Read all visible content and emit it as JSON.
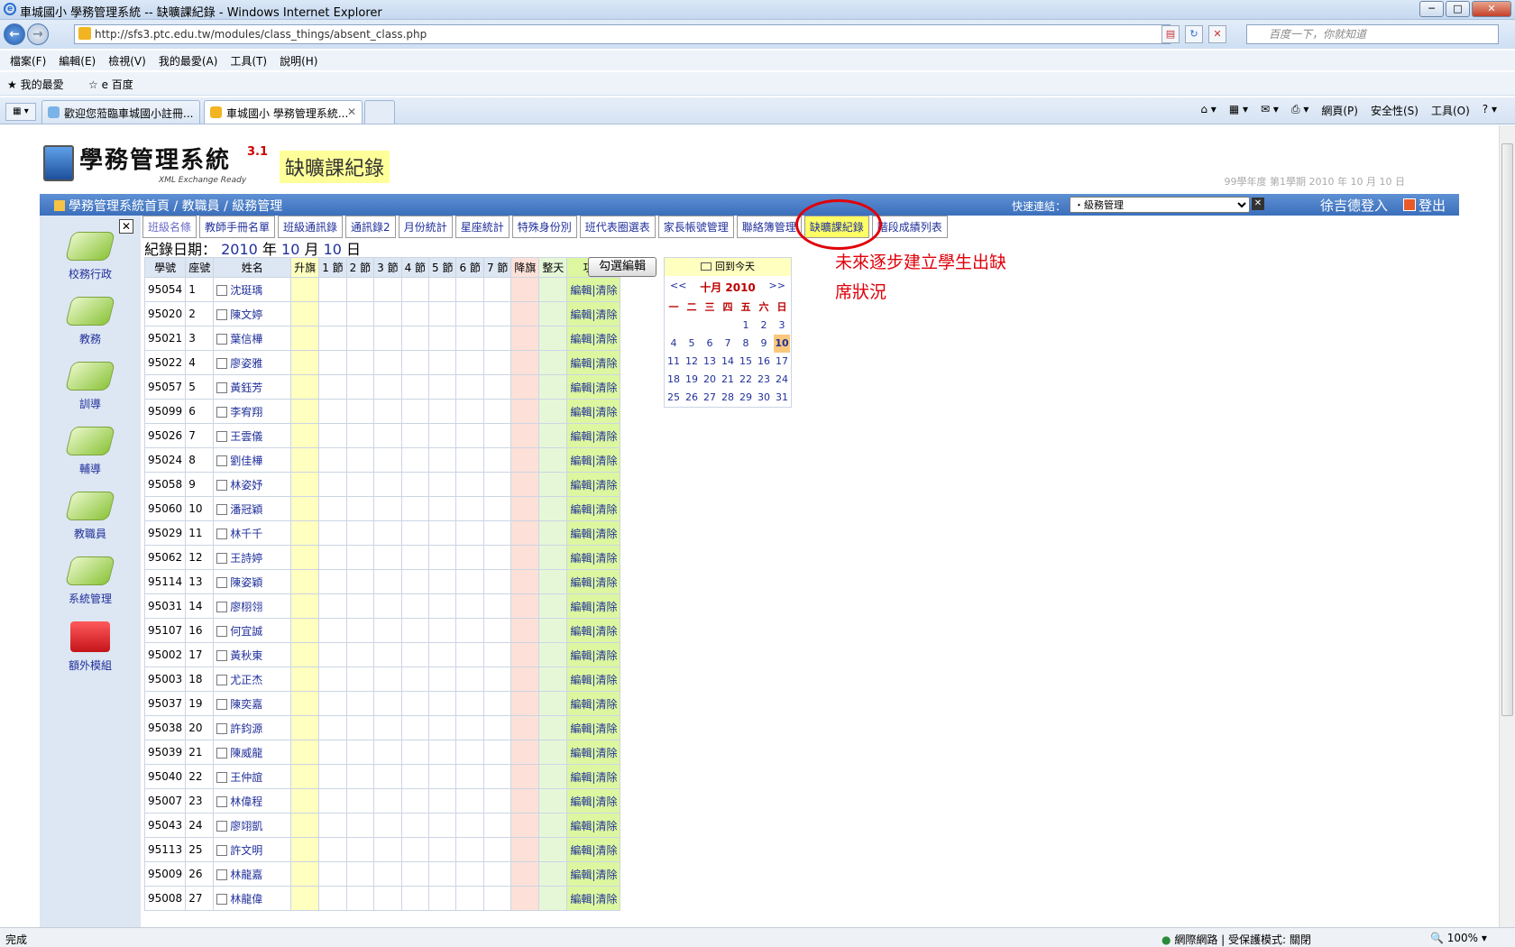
{
  "browser": {
    "window_title": "車城國小 學務管理系統 -- 缺曠課紀錄 - Windows Internet Explorer",
    "url": "http://sfs3.ptc.edu.tw/modules/class_things/absent_class.php",
    "search_placeholder": "百度一下，你就知道",
    "menu": [
      "檔案(F)",
      "編輯(E)",
      "檢視(V)",
      "我的最愛(A)",
      "工具(T)",
      "說明(H)"
    ],
    "favorites_label": "我的最愛",
    "fav_link": "百度",
    "tabs": [
      {
        "label": "歡迎您蒞臨車城國小註冊..."
      },
      {
        "label": "車城國小 學務管理系統..."
      }
    ],
    "command_bar": [
      "網頁(P)",
      "安全性(S)",
      "工具(O)"
    ],
    "status_text": "完成",
    "zone_text": "網際網路 | 受保護模式: 關閉",
    "zoom": "100%"
  },
  "header": {
    "logo_name": "學務管理系統",
    "logo_version": "3.1",
    "logo_tagline": "XML Exchange Ready",
    "page_title": "缺曠課紀錄",
    "semester": "99學年度 第1學期 2010 年 10 月 10 日",
    "breadcrumb": "學務管理系統首頁 / 教職員 / 級務管理",
    "quick_link_label": "快速連結：",
    "quick_link_value": "・級務管理",
    "user": "徐吉德登入",
    "logout": "登出"
  },
  "sidebar": {
    "items": [
      {
        "label": "校務行政",
        "icon": "green-pad-icon"
      },
      {
        "label": "教務",
        "icon": "green-pad-icon"
      },
      {
        "label": "訓導",
        "icon": "green-pad-icon"
      },
      {
        "label": "輔導",
        "icon": "green-pad-icon"
      },
      {
        "label": "教職員",
        "icon": "green-pad-icon"
      },
      {
        "label": "系統管理",
        "icon": "green-pad-icon"
      },
      {
        "label": "額外模組",
        "icon": "red-folder-icon"
      }
    ]
  },
  "nav_tabs": [
    {
      "label": "班級名條"
    },
    {
      "label": "教師手冊名單"
    },
    {
      "label": "班級通訊錄"
    },
    {
      "label": "通訊錄2"
    },
    {
      "label": "月份統計"
    },
    {
      "label": "星座統計"
    },
    {
      "label": "特殊身份別"
    },
    {
      "label": "班代表圈選表"
    },
    {
      "label": "家長帳號管理"
    },
    {
      "label": "聯絡簿管理"
    },
    {
      "label": "缺曠課紀錄"
    },
    {
      "label": "階段成績列表"
    }
  ],
  "record": {
    "prefix": "紀錄日期：",
    "year": "2010",
    "year_unit": "年",
    "month": "10",
    "month_unit": "月",
    "day": "10",
    "day_unit": "日"
  },
  "table": {
    "headers": [
      "學號",
      "座號",
      "姓名",
      "升旗",
      "1 節",
      "2 節",
      "3 節",
      "4 節",
      "5 節",
      "6 節",
      "7 節",
      "降旗",
      "整天",
      "功能"
    ],
    "action_label": "編輯|清除",
    "rows": [
      {
        "id": "95054",
        "seat": "1",
        "name": "沈珽瑀"
      },
      {
        "id": "95020",
        "seat": "2",
        "name": "陳文婷"
      },
      {
        "id": "95021",
        "seat": "3",
        "name": "葉信樺"
      },
      {
        "id": "95022",
        "seat": "4",
        "name": "廖姿雅"
      },
      {
        "id": "95057",
        "seat": "5",
        "name": "黃鈺芳"
      },
      {
        "id": "95099",
        "seat": "6",
        "name": "李宥翔"
      },
      {
        "id": "95026",
        "seat": "7",
        "name": "王雲儀"
      },
      {
        "id": "95024",
        "seat": "8",
        "name": "劉佳樺"
      },
      {
        "id": "95058",
        "seat": "9",
        "name": "林姿妤"
      },
      {
        "id": "95060",
        "seat": "10",
        "name": "潘冠穎"
      },
      {
        "id": "95029",
        "seat": "11",
        "name": "林千千"
      },
      {
        "id": "95062",
        "seat": "12",
        "name": "王詩婷"
      },
      {
        "id": "95114",
        "seat": "13",
        "name": "陳姿穎"
      },
      {
        "id": "95031",
        "seat": "14",
        "name": "廖栩翎"
      },
      {
        "id": "95107",
        "seat": "16",
        "name": "何宜誠"
      },
      {
        "id": "95002",
        "seat": "17",
        "name": "黃秋東"
      },
      {
        "id": "95003",
        "seat": "18",
        "name": "尤正杰"
      },
      {
        "id": "95037",
        "seat": "19",
        "name": "陳奕嘉"
      },
      {
        "id": "95038",
        "seat": "20",
        "name": "許鈞源"
      },
      {
        "id": "95039",
        "seat": "21",
        "name": "陳威龍"
      },
      {
        "id": "95040",
        "seat": "22",
        "name": "王仲誼"
      },
      {
        "id": "95007",
        "seat": "23",
        "name": "林偉程"
      },
      {
        "id": "95043",
        "seat": "24",
        "name": "廖翊凱"
      },
      {
        "id": "95113",
        "seat": "25",
        "name": "許文明"
      },
      {
        "id": "95009",
        "seat": "26",
        "name": "林龍嘉"
      },
      {
        "id": "95008",
        "seat": "27",
        "name": "林龍偉"
      }
    ]
  },
  "check_edit_button": "勾選編輯",
  "calendar": {
    "today_label": "回到今天",
    "prev": "<<",
    "next": ">>",
    "month_label": "十月 2010",
    "weekdays": [
      "一",
      "二",
      "三",
      "四",
      "五",
      "六",
      "日"
    ],
    "weeks": [
      [
        "",
        "",
        "",
        "",
        "1",
        "2",
        "3"
      ],
      [
        "4",
        "5",
        "6",
        "7",
        "8",
        "9",
        "10"
      ],
      [
        "11",
        "12",
        "13",
        "14",
        "15",
        "16",
        "17"
      ],
      [
        "18",
        "19",
        "20",
        "21",
        "22",
        "23",
        "24"
      ],
      [
        "25",
        "26",
        "27",
        "28",
        "29",
        "30",
        "31"
      ]
    ],
    "selected_day": "10"
  },
  "annotation": {
    "line1": "未來逐步建立學生出缺",
    "line2": "席狀況"
  }
}
